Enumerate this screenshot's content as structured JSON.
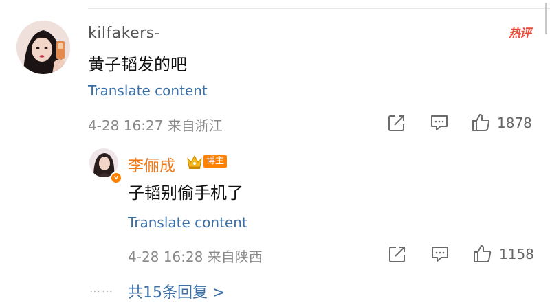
{
  "comment": {
    "username": "kilfakers-",
    "hot_label": "热评",
    "text": "黄子韬发的吧",
    "translate_label": "Translate content",
    "timestamp": "4-28 16:27",
    "location": "来自浙江",
    "like_count": "1878"
  },
  "reply": {
    "username": "李俪成",
    "badge_label": "博主",
    "text": "子韬别偷手机了",
    "translate_label": "Translate content",
    "timestamp": "4-28 16:28",
    "location": "来自陕西",
    "like_count": "1158"
  },
  "thread": {
    "dots": "……",
    "more_replies_label": "共15条回复 >"
  },
  "colors": {
    "link": "#3a6fa8",
    "accent_orange": "#ff8200",
    "hot_red": "#ef4a3a",
    "meta_gray": "#8a8a8a"
  },
  "icons": [
    "share-icon",
    "comment-icon",
    "like-icon",
    "crown-icon",
    "verified-icon"
  ]
}
